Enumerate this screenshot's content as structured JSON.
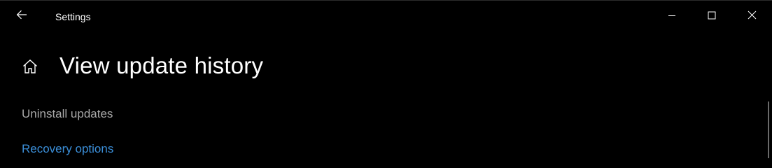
{
  "window": {
    "title": "Settings",
    "controls": {
      "minimize_icon": "minimize-icon",
      "maximize_icon": "maximize-icon",
      "close_icon": "close-icon"
    },
    "back_icon": "back-arrow-icon"
  },
  "page": {
    "home_icon": "home-icon",
    "title": "View update history",
    "links": {
      "uninstall": "Uninstall updates",
      "recovery": "Recovery options"
    }
  },
  "colors": {
    "background": "#000000",
    "text": "#ffffff",
    "muted_link": "#a8a8a8",
    "accent_link": "#3b8fd9"
  }
}
